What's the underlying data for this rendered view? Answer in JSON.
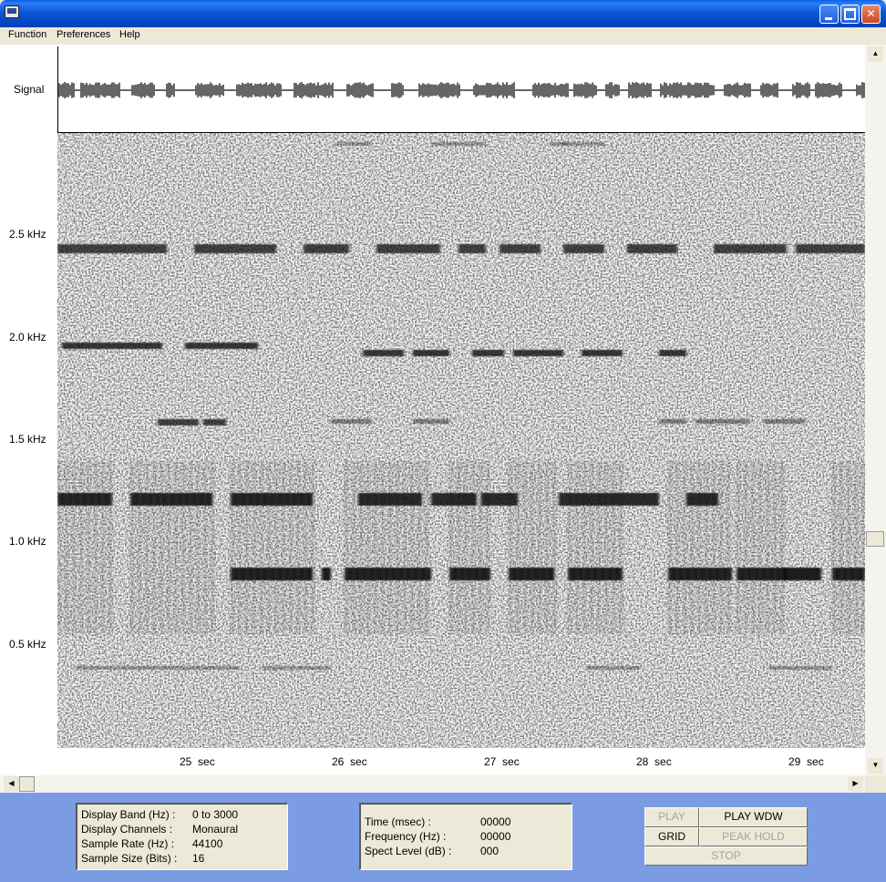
{
  "menu": {
    "items": [
      "Function",
      "Preferences",
      "Help"
    ]
  },
  "plot": {
    "signal_label": "Signal",
    "freq_labels": [
      "2.5 kHz",
      "2.0 kHz",
      "1.5 kHz",
      "1.0 kHz",
      "0.5 kHz"
    ],
    "time_labels": [
      "25  sec",
      "26  sec",
      "27  sec",
      "28  sec",
      "29  sec"
    ]
  },
  "info": {
    "band_label": "Display Band (Hz) :",
    "band_value": "0 to 3000",
    "channels_label": "Display Channels :",
    "channels_value": "Monaural",
    "rate_label": "Sample Rate (Hz) :",
    "rate_value": "44100",
    "size_label": "Sample Size (Bits) :",
    "size_value": "16"
  },
  "readout": {
    "time_label": "Time (msec) :",
    "time_value": "00000",
    "freq_label": "Frequency (Hz) :",
    "freq_value": "00000",
    "level_label": "Spect Level (dB) :",
    "level_value": "000"
  },
  "buttons": {
    "play": "PLAY",
    "play_wdw": "PLAY WDW",
    "grid": "GRID",
    "peak_hold": "PEAK HOLD",
    "stop": "STOP"
  },
  "icons": {
    "app": "app-icon",
    "minimize": "minimize-icon",
    "maximize": "maximize-icon",
    "close": "close-icon"
  }
}
